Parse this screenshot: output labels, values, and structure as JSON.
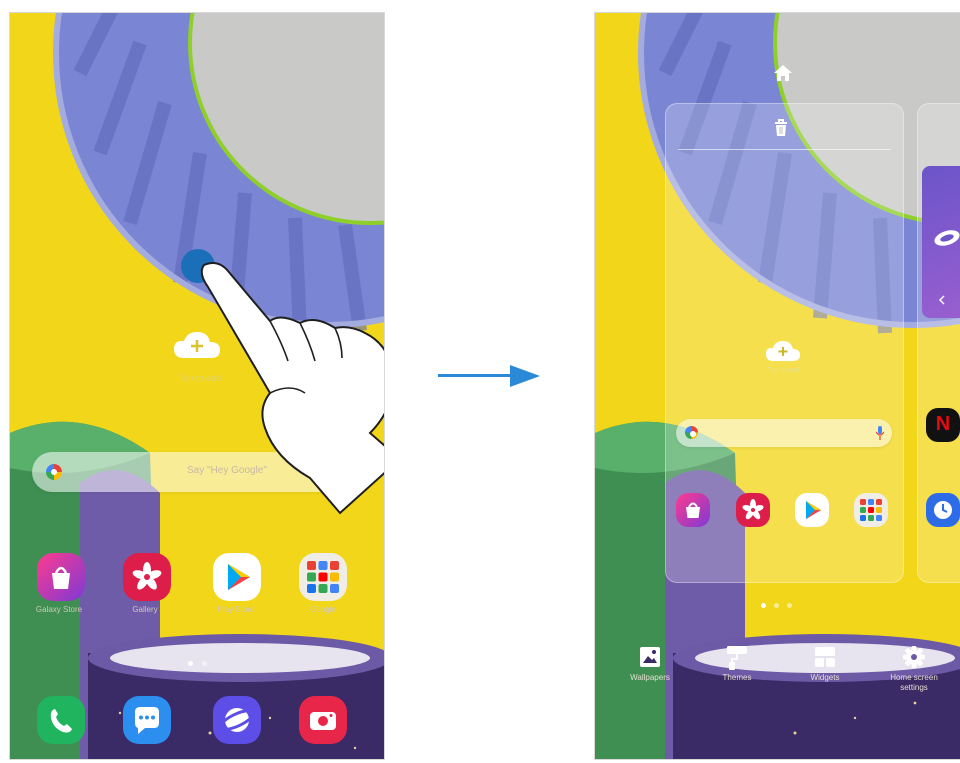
{
  "left_screen": {
    "cloud_add_label": "Tap to add",
    "search_hint": "Say \"Hey Google\"",
    "apps": [
      {
        "name": "Galaxy Store",
        "icon": "galaxy-store-icon"
      },
      {
        "name": "Gallery",
        "icon": "gallery-icon"
      },
      {
        "name": "Play Store",
        "icon": "play-store-icon"
      },
      {
        "name": "Google",
        "icon": "google-folder-icon"
      }
    ],
    "dock": [
      {
        "icon": "phone-icon"
      },
      {
        "icon": "messages-icon"
      },
      {
        "icon": "internet-icon"
      },
      {
        "icon": "camera-icon"
      }
    ],
    "page_indicator": {
      "count": 2,
      "active": 0
    }
  },
  "right_screen": {
    "home_icon": "home-icon",
    "trash_icon": "trash-icon",
    "cloud_add_label": "Tap to add",
    "page_indicator": {
      "count": 3,
      "active": 0
    },
    "bottom_options": [
      {
        "label": "Wallpapers",
        "icon": "wallpaper-icon"
      },
      {
        "label": "Themes",
        "icon": "themes-icon"
      },
      {
        "label": "Widgets",
        "icon": "widgets-icon"
      },
      {
        "label": "Home screen\nsettings",
        "icon": "settings-icon"
      }
    ],
    "next_page_apps": [
      {
        "icon": "netflix-icon",
        "label": "N"
      },
      {
        "icon": "clock-icon"
      }
    ]
  },
  "colors": {
    "wallpaper_yellow": "#f2d61a",
    "fan_blue": "#7a86d4",
    "accent_green": "#8fcf2a",
    "arrow_blue": "#2b8ad8",
    "touch_blue": "#1a6fb8"
  }
}
